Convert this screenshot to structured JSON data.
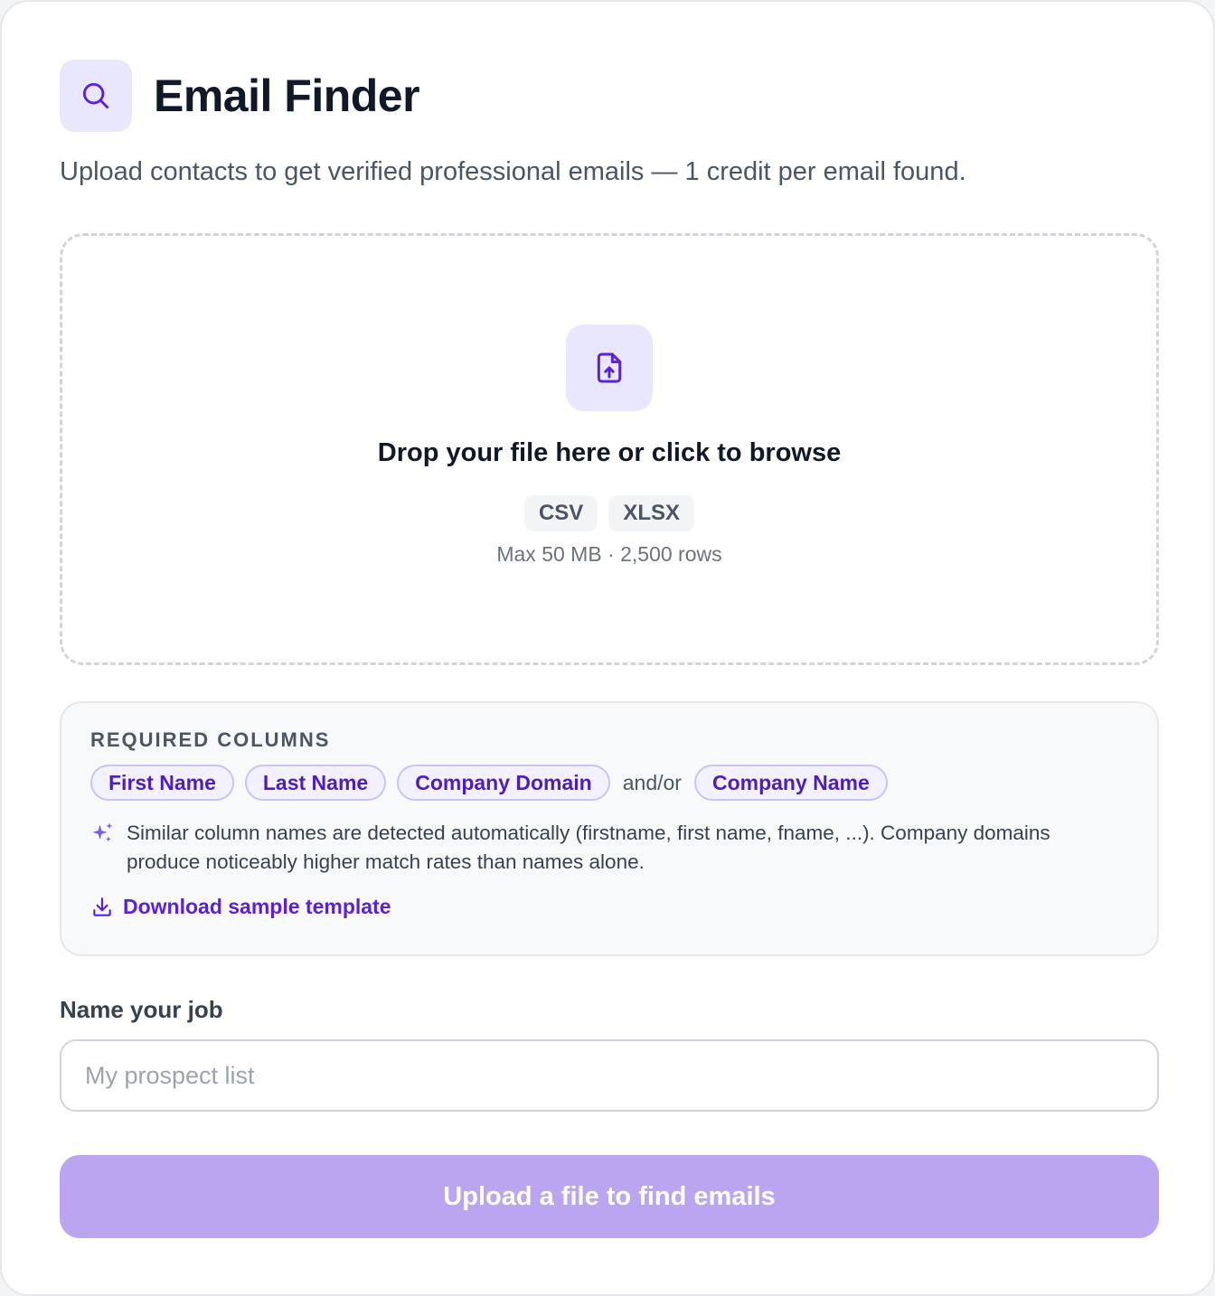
{
  "header": {
    "icon": "search-icon",
    "title": "Email Finder",
    "subtitle": "Upload contacts to get verified professional emails — 1 credit per email found."
  },
  "dropzone": {
    "icon": "file-upload-icon",
    "title": "Drop your file here or click to browse",
    "formats": [
      "CSV",
      "XLSX"
    ],
    "limits": "Max 50 MB · 2,500 rows"
  },
  "required": {
    "heading": "REQUIRED COLUMNS",
    "columns": [
      "First Name",
      "Last Name",
      "Company Domain"
    ],
    "separator": "and/or",
    "alt_column": "Company Name",
    "hint_icon": "sparkles-icon",
    "hint": "Similar column names are detected automatically (firstname, first name, fname, ...). Company domains produce noticeably higher match rates than names alone.",
    "download_icon": "download-icon",
    "download_label": "Download sample template"
  },
  "job": {
    "label": "Name your job",
    "placeholder": "My prospect list",
    "value": ""
  },
  "submit": {
    "label": "Upload a file to find emails",
    "disabled": true
  },
  "colors": {
    "accent": "#5b21d6",
    "icon_bg": "#e8e7fd",
    "button_disabled": "#bba4f0"
  }
}
